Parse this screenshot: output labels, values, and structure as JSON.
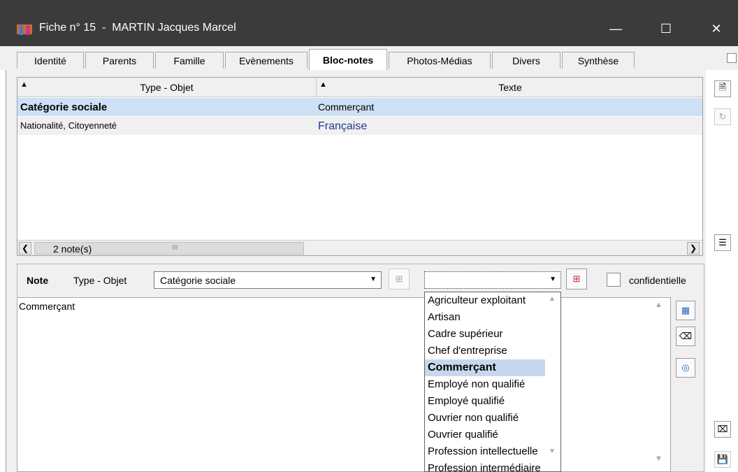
{
  "window": {
    "title": "Fiche n° 15  -  MARTIN Jacques Marcel",
    "buttons": {
      "minimize": "—",
      "maximize": "☐",
      "close": "✕"
    }
  },
  "tabs": [
    "Identité",
    "Parents",
    "Famille",
    "Evènements",
    "Bloc-notes",
    "Photos-Médias",
    "Divers",
    "Synthèse"
  ],
  "active_tab": "Bloc-notes",
  "grid": {
    "col1_header": "Type - Objet",
    "col2_header": "Texte",
    "rows": [
      {
        "type": "Catégorie sociale",
        "texte": "Commerçant"
      },
      {
        "type": "Nationalité, Citoyenneté",
        "texte": "Française"
      }
    ],
    "status": "2  note(s)",
    "scroll_grip": "III"
  },
  "note": {
    "label": "Note",
    "type_label": "Type - Objet",
    "type_value": "Catégorie sociale",
    "text_value": "",
    "confidential_label": "confidentielle",
    "body": "Commerçant"
  },
  "dropdown": {
    "items": [
      "Agriculteur exploitant",
      "Artisan",
      "Cadre supérieur",
      "Chef d'entreprise",
      "Commerçant",
      "Employé non qualifié",
      "Employé qualifié",
      "Ouvrier non qualifié",
      "Ouvrier qualifié",
      "Profession intellectuelle",
      "Profession intermédiaire"
    ],
    "selected": "Commerçant"
  },
  "colors": {
    "titlebar": "#3b3b3b",
    "selection": "#c5d8ee",
    "accent_text": "#1f3a93"
  }
}
